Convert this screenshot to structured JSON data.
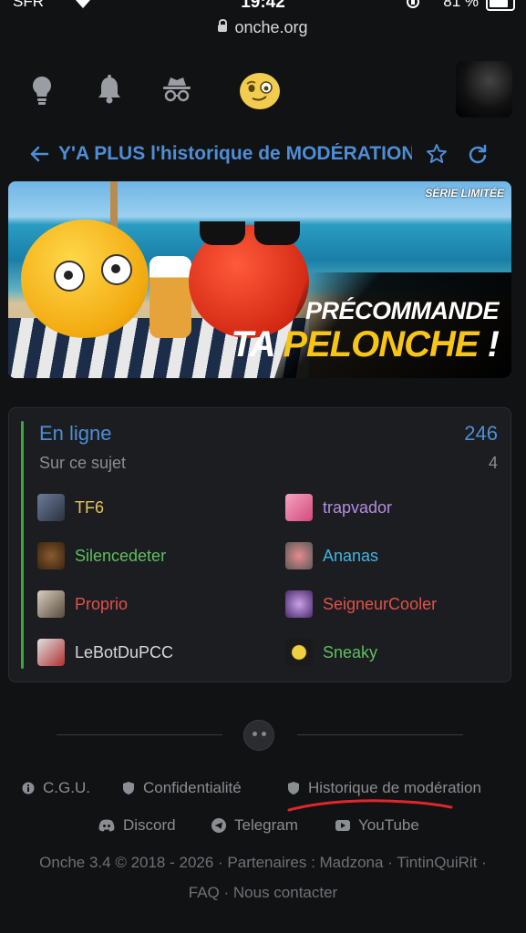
{
  "status_bar": {
    "carrier": "SFR",
    "time": "19:42",
    "battery": "81 %"
  },
  "browser": {
    "url": "onche.org"
  },
  "nav": {
    "icons": [
      "lightbulb-icon",
      "bell-icon",
      "incognito-icon",
      "onche-smiley-icon"
    ]
  },
  "topic": {
    "title": "Y'A PLUS l'historique de MODÉRATION"
  },
  "banner": {
    "badge": "SÉRIE LIMITÉE",
    "line1": "PRÉCOMMANDE",
    "line2_white": "TA ",
    "line2_yellow": "PELONCHE",
    "line2_end": " !"
  },
  "online": {
    "title": "En ligne",
    "total": "246",
    "subtitle": "Sur ce sujet",
    "subtopic_count": "4",
    "users": [
      {
        "name": "TF6",
        "color": "#e8c456",
        "col": 0
      },
      {
        "name": "trapvador",
        "color": "#b58ce0",
        "col": 1
      },
      {
        "name": "Silencedeter",
        "color": "#5fbf5f",
        "col": 0
      },
      {
        "name": "Ananas",
        "color": "#43b3e0",
        "col": 1
      },
      {
        "name": "Proprio",
        "color": "#e2504a",
        "col": 0
      },
      {
        "name": "SeigneurCooler",
        "color": "#e2504a",
        "col": 1
      },
      {
        "name": "LeBotDuPCC",
        "color": "#d8d8d8",
        "col": 0
      },
      {
        "name": "Sneaky",
        "color": "#5fbf5f",
        "col": 1
      }
    ]
  },
  "footer": {
    "links_row1": [
      "C.G.U.",
      "Confidentialité",
      "Historique de modération"
    ],
    "links_row2": [
      "Discord",
      "Telegram",
      "YouTube"
    ],
    "copyright_line1": "Onche 3.4 © 2018 - 2026 · Partenaires : Madzona · TintinQuiRit ·",
    "copyright_line2": "FAQ · Nous contacter"
  },
  "colors": {
    "accent": "#4e8ed6",
    "online_bar": "#3fa53f",
    "annotation": "#e0262a"
  }
}
